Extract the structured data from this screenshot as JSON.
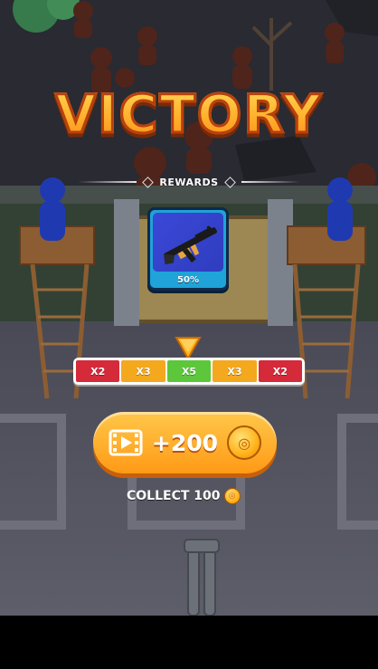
{
  "title": "VICTORY",
  "rewards_label": "REWARDS",
  "reward_item": {
    "name_icon": "assault-rifle-icon",
    "percent": "50%",
    "card_color": "#1fa3d8"
  },
  "multipliers": [
    {
      "label": "X2",
      "color": "#d42a3a"
    },
    {
      "label": "X3",
      "color": "#f4a81d"
    },
    {
      "label": "X5",
      "color": "#5cc73a"
    },
    {
      "label": "X3",
      "color": "#f4a81d"
    },
    {
      "label": "X2",
      "color": "#d42a3a"
    }
  ],
  "selected_multiplier_index": 2,
  "claim_button": {
    "label": "+200",
    "video_icon": "video-ad-icon",
    "coin_icon": "coin-icon"
  },
  "collect": {
    "label": "COLLECT 100",
    "coin_icon": "coin-icon"
  }
}
